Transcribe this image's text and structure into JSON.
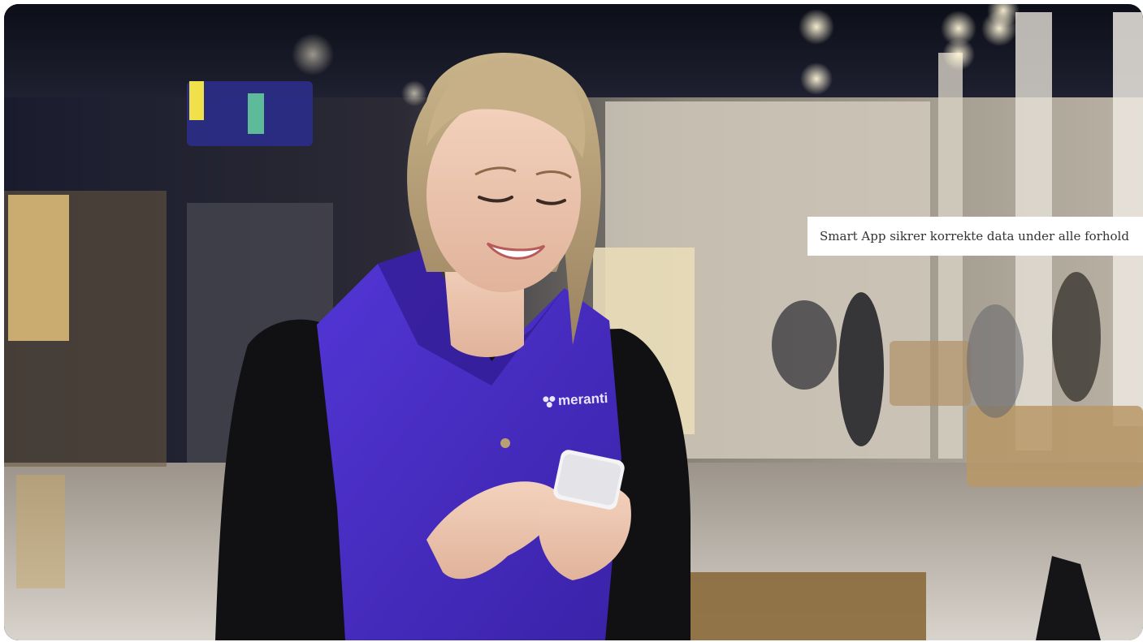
{
  "hero": {
    "caption": "Smart App sikrer korrekte data under alle forhold",
    "brand_logo_text": "meranti",
    "alt_subject": "woman-in-purple-vest-using-smartphone",
    "colors": {
      "vest": "#4a2fc4",
      "caption_bg": "#ffffff",
      "caption_text": "#333333"
    }
  }
}
